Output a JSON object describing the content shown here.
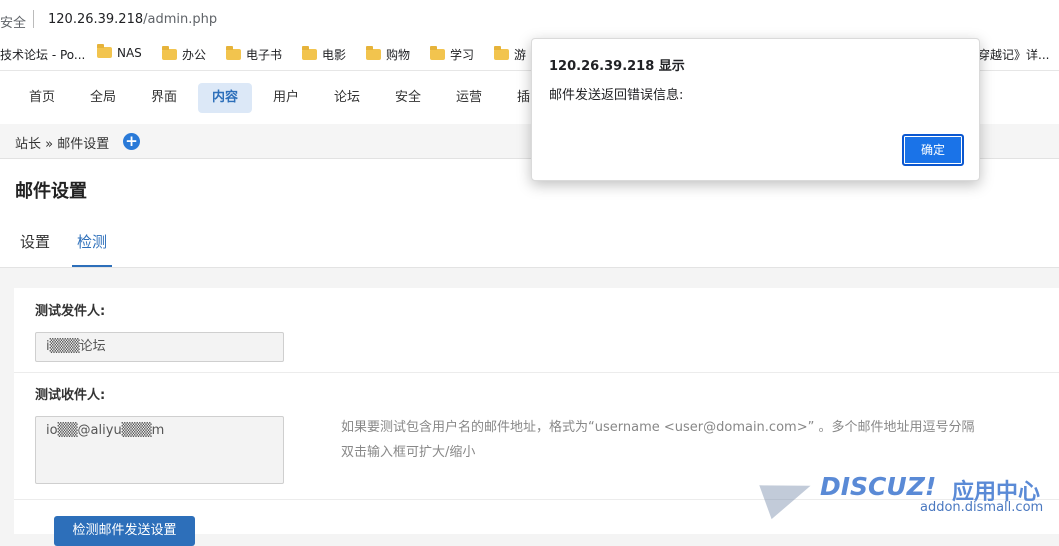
{
  "address": {
    "security": "安全",
    "host": "120.26.39.218",
    "path": "/admin.php"
  },
  "bookmarks": [
    {
      "label": "技术论坛 - Po...",
      "folder": false
    },
    {
      "label": "NAS",
      "folder": true
    },
    {
      "label": "办公",
      "folder": true
    },
    {
      "label": "电子书",
      "folder": true
    },
    {
      "label": "电影",
      "folder": true
    },
    {
      "label": "购物",
      "folder": true
    },
    {
      "label": "学习",
      "folder": true
    },
    {
      "label": "游",
      "folder": true
    },
    {
      "label": "穿越记》详...",
      "folder": false
    }
  ],
  "nav": [
    "首页",
    "全局",
    "界面",
    "内容",
    "用户",
    "论坛",
    "安全",
    "运营",
    "插"
  ],
  "nav_active": "内容",
  "breadcrumb": "站长 » 邮件设置",
  "page": {
    "title": "邮件设置",
    "tabs": [
      "设置",
      "检测"
    ],
    "active_tab": "检测"
  },
  "form": {
    "sender_label": "测试发件人:",
    "sender_value": "i▒▒▒论坛",
    "recipient_label": "测试收件人:",
    "recipient_value": "io▒▒@aliyu▒▒▒m",
    "hint1": "如果要测试包含用户名的邮件地址，格式为“username <user@domain.com>” 。多个邮件地址用逗号分隔",
    "hint2": "双击输入框可扩大/缩小",
    "submit": "检测邮件发送设置"
  },
  "watermark": {
    "logo": "DISCUZ!",
    "cn": "应用中心",
    "domain": "addon.dismall.com"
  },
  "dialog": {
    "title": "120.26.39.218 显示",
    "message": "邮件发送返回错误信息:",
    "ok": "确定"
  },
  "colors": {
    "accent": "#2d6fba",
    "dialog_button": "#1a73e8"
  }
}
